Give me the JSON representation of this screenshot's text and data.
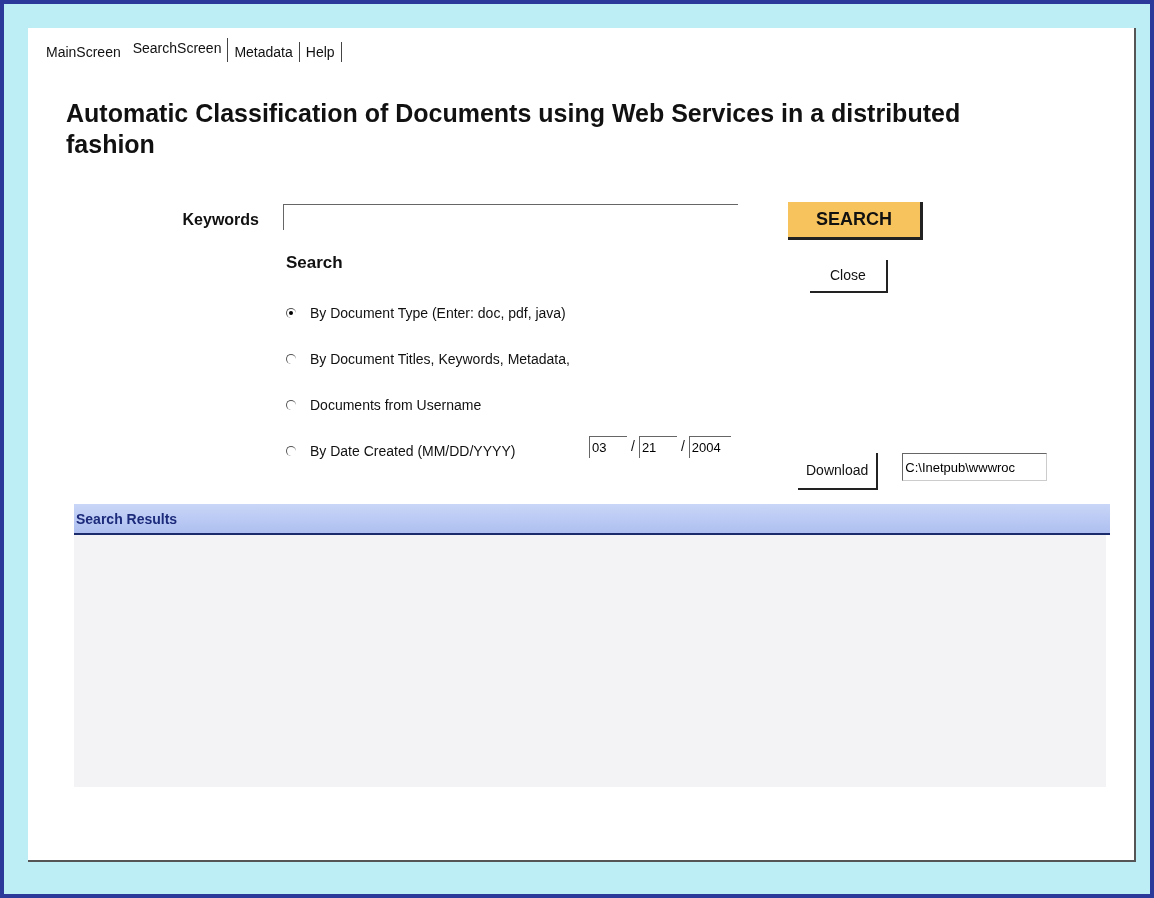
{
  "tabs": [
    {
      "label": "MainScreen",
      "selected": false
    },
    {
      "label": "SearchScreen",
      "selected": true
    },
    {
      "label": "Metadata",
      "selected": false
    },
    {
      "label": "Help",
      "selected": false
    }
  ],
  "title": "Automatic Classification of Documents using Web Services in a distributed fashion",
  "keywords": {
    "label": "Keywords"
  },
  "search_button": "SEARCH",
  "search_heading": "Search",
  "close_button": "Close",
  "options": [
    {
      "label": "By Document Type (Enter: doc, pdf, java)",
      "selected": true
    },
    {
      "label": "By Document Titles, Keywords, Metadata,",
      "selected": false
    },
    {
      "label": "Documents from Username",
      "selected": false
    },
    {
      "label": "By Date Created (MM/DD/YYYY)",
      "selected": false
    }
  ],
  "date": {
    "month": "03",
    "separator_1": "/",
    "day": "21",
    "separator_2": "/",
    "year": "2004"
  },
  "download_button": "Download",
  "download_path": "C:\\Inetpub\\wwwroc",
  "results": {
    "title": "Search Results"
  }
}
